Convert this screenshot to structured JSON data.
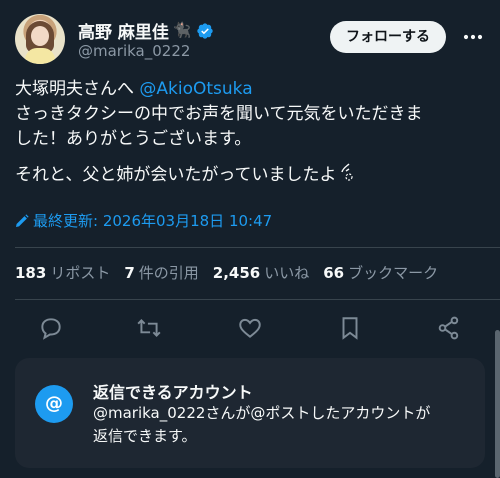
{
  "user": {
    "display_name": "高野 麻里佳",
    "handle": "@marika_0222",
    "cat_emoji": "🐈‍⬛"
  },
  "follow_label": "フォローする",
  "tweet": {
    "line1_prefix": "大塚明夫さんへ ",
    "line1_mention": "@AkioOtsuka",
    "line2": "さっきタクシーの中でお声を聞いて元気をいただきま",
    "line3": "した！ありがとうございます。",
    "line4": "それと、父と姉が会いたがっていましたよ"
  },
  "edited_label": "最終更新: 2026年03月18日 10:47",
  "stats": {
    "reposts_count": "183",
    "reposts_label": "リポスト",
    "quotes_count": "7",
    "quotes_label": "件の引用",
    "likes_count": "2,456",
    "likes_label": "いいね",
    "bookmarks_count": "66",
    "bookmarks_label": "ブックマーク"
  },
  "reply_card": {
    "icon_text": "@",
    "title": "返信できるアカウント",
    "body_line1": "@marika_0222さんが@ポストしたアカウントが",
    "body_line2": "返信できます。"
  },
  "colors": {
    "background": "#15202b",
    "accent": "#1d9bf0",
    "muted": "#8b98a5"
  }
}
